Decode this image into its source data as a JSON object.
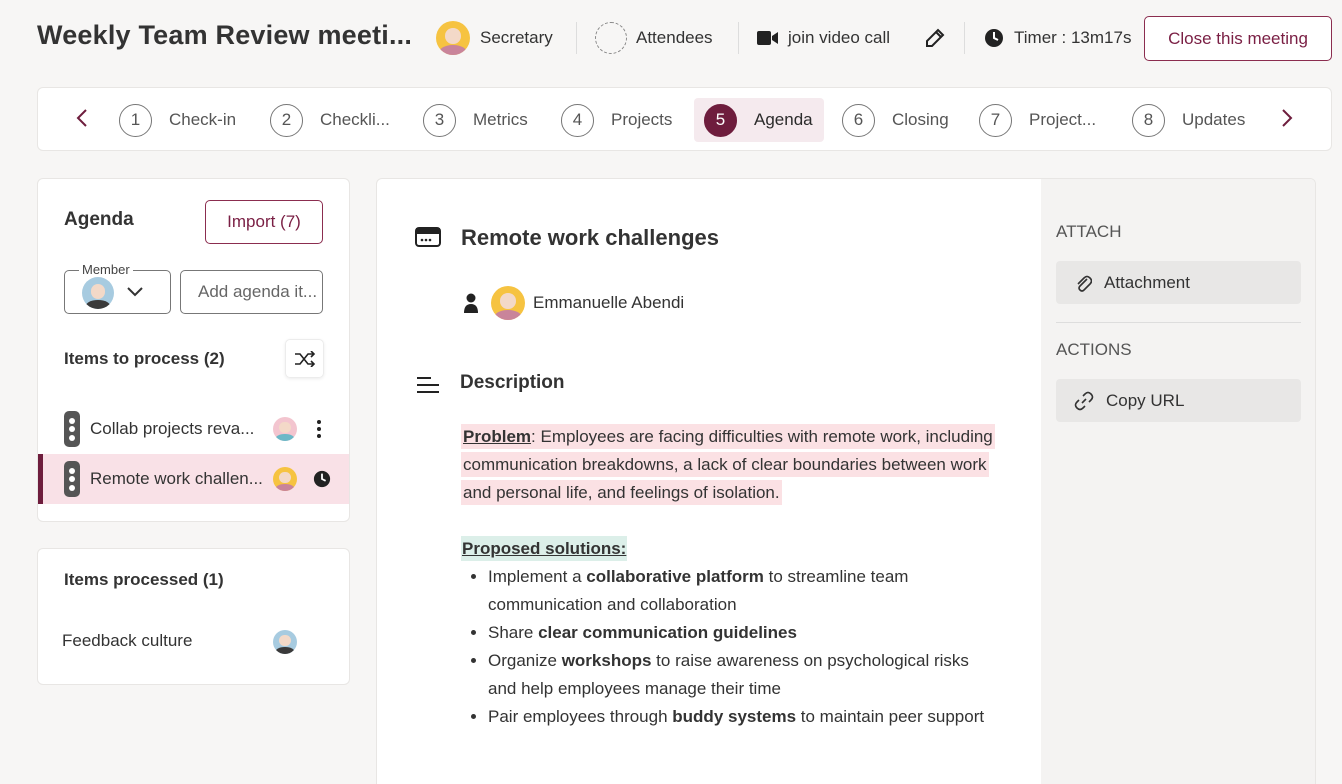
{
  "header": {
    "title": "Weekly Team Review meeti...",
    "secretary_label": "Secretary",
    "attendees_label": "Attendees",
    "video_label": "join video call",
    "timer_label": "Timer : 13m17s",
    "close_label": "Close this meeting"
  },
  "steps": [
    {
      "num": "1",
      "label": "Check-in"
    },
    {
      "num": "2",
      "label": "Checkli..."
    },
    {
      "num": "3",
      "label": "Metrics"
    },
    {
      "num": "4",
      "label": "Projects"
    },
    {
      "num": "5",
      "label": "Agenda"
    },
    {
      "num": "6",
      "label": "Closing"
    },
    {
      "num": "7",
      "label": "Project..."
    },
    {
      "num": "8",
      "label": "Updates"
    }
  ],
  "agenda": {
    "title": "Agenda",
    "import_label": "Import (7)",
    "member_label": "Member",
    "add_placeholder": "Add agenda it...",
    "to_process_title": "Items to process (2)",
    "to_process": [
      {
        "label": "Collab projects reva..."
      },
      {
        "label": "Remote work challen..."
      }
    ],
    "processed_title": "Items processed (1)",
    "processed": [
      {
        "label": "Feedback culture"
      }
    ]
  },
  "item": {
    "title": "Remote work challenges",
    "owner": "Emmanuelle Abendi",
    "description_title": "Description",
    "problem_label": "Problem",
    "problem_text": ": Employees are facing difficulties with remote work, including communication breakdowns, a lack of clear boundaries between work and personal life, and feelings of isolation.",
    "solutions_label": "Proposed solutions:",
    "solutions": [
      {
        "pre": "Implement a ",
        "bold": "collaborative platform",
        "post": " to streamline team communication and collaboration"
      },
      {
        "pre": "Share ",
        "bold": "clear communication guidelines",
        "post": ""
      },
      {
        "pre": "Organize ",
        "bold": "workshops",
        "post": " to raise awareness on psychological risks and help employees manage their time"
      },
      {
        "pre": "Pair employees through ",
        "bold": "buddy systems",
        "post": " to maintain peer support"
      }
    ]
  },
  "sidebar": {
    "attach_heading": "ATTACH",
    "attachment_label": "Attachment",
    "actions_heading": "ACTIONS",
    "copy_url_label": "Copy URL"
  },
  "colors": {
    "accent": "#6e1d3d",
    "problem_highlight": "#fbe1e4",
    "solutions_highlight": "#dcefe9"
  }
}
